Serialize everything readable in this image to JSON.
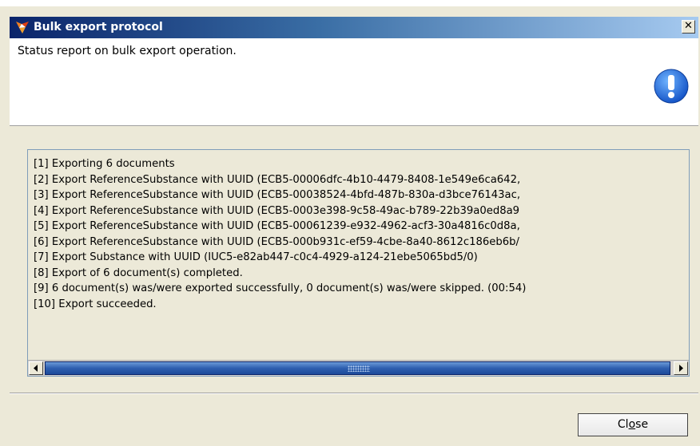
{
  "window": {
    "title": "Bulk export protocol",
    "close_glyph": "✕"
  },
  "header": {
    "message": "Status report on bulk export operation.",
    "icon": "info-exclamation-icon"
  },
  "log": {
    "lines": [
      "[1] Exporting 6 documents",
      "[2] Export ReferenceSubstance with UUID (ECB5-00006dfc-4b10-4479-8408-1e549e6ca642,",
      "[3] Export ReferenceSubstance with UUID (ECB5-00038524-4bfd-487b-830a-d3bce76143ac,",
      "[4] Export ReferenceSubstance with UUID (ECB5-0003e398-9c58-49ac-b789-22b39a0ed8a9",
      "[5] Export ReferenceSubstance with UUID (ECB5-00061239-e932-4962-acf3-30a4816c0d8a,",
      "[6] Export ReferenceSubstance with UUID (ECB5-000b931c-ef59-4cbe-8a40-8612c186eb6b/",
      "[7] Export Substance with UUID (IUC5-e82ab447-c0c4-4929-a124-21ebe5065bd5/0)",
      "[8] Export of 6 document(s) completed.",
      "[9] 6 document(s) was/were exported successfully, 0 document(s) was/were skipped. (00:54)",
      "[10] Export succeeded."
    ]
  },
  "footer": {
    "close_button": {
      "pre": "Cl",
      "mnemonic": "o",
      "post": "se"
    }
  },
  "colors": {
    "title_start": "#0a246a",
    "title_end": "#a6caf0",
    "dialog_bg": "#ece9d8",
    "info_icon": "#1e6fd9"
  }
}
